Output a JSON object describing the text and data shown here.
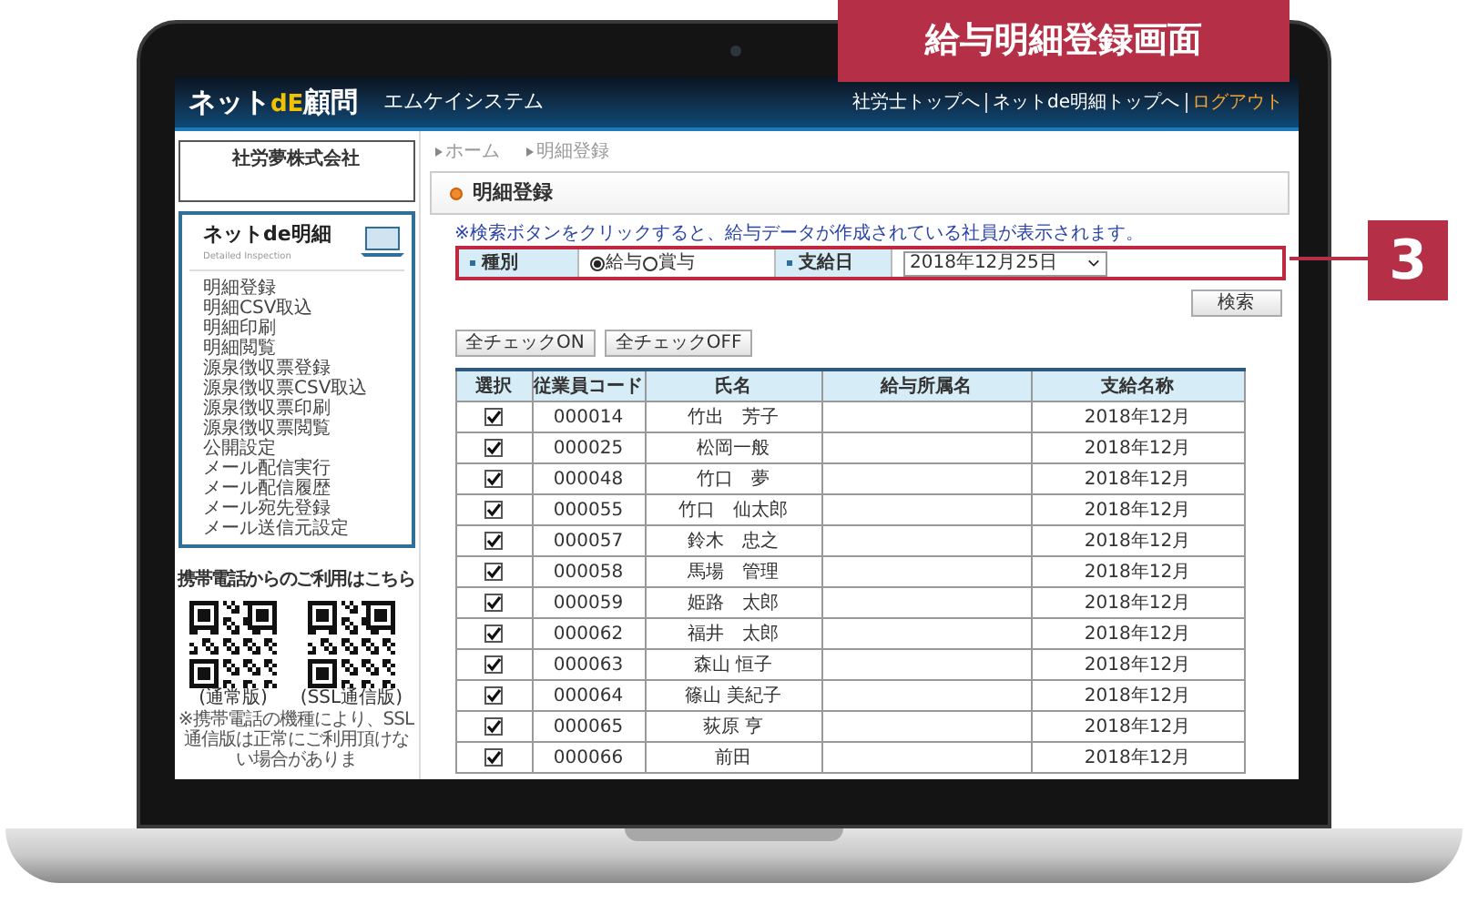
{
  "banner": {
    "title": "給与明細登録画面"
  },
  "callout": {
    "label": "3"
  },
  "header": {
    "logo": {
      "prefix": "ネット",
      "middle": "dE",
      "suffix": "顧問"
    },
    "company": "エムケイシステム",
    "links": [
      {
        "label": "社労士トップへ",
        "kind": "nav"
      },
      {
        "label": "ネットde明細トップへ",
        "kind": "nav"
      },
      {
        "label": "ログアウト",
        "kind": "logout"
      }
    ]
  },
  "sidebar": {
    "company": "社労夢株式会社",
    "menu": {
      "title": "ネットde明細",
      "subtitle": "Detailed Inspection",
      "items": [
        "明細登録",
        "明細CSV取込",
        "明細印刷",
        "明細閲覧",
        "源泉徴収票登録",
        "源泉徴収票CSV取込",
        "源泉徴収票印刷",
        "源泉徴収票閲覧",
        "公開設定",
        "メール配信実行",
        "メール配信履歴",
        "メール宛先登録",
        "メール送信元設定"
      ]
    },
    "mobile": {
      "heading": "携帯電話からのご利用はこちら",
      "qr_labels": [
        "(通常版)",
        "(SSL通信版)"
      ],
      "note": "※携帯電話の機種により、SSL通信版は正常にご利用頂けない場合がありま"
    }
  },
  "main": {
    "breadcrumb": [
      "ホーム",
      "明細登録"
    ],
    "page_title": "明細登録",
    "notice": "※検索ボタンをクリックすると、給与データが作成されている社員が表示されます。",
    "form": {
      "type_label": "種別",
      "options": [
        {
          "label": "給与",
          "selected": true
        },
        {
          "label": "賞与",
          "selected": false
        }
      ],
      "date_label": "支給日",
      "date_value": "2018年12月25日"
    },
    "search_button": "検索",
    "bulk_buttons": [
      "全チェックON",
      "全チェックOFF"
    ],
    "table": {
      "columns": [
        "選択",
        "従業員コード",
        "氏名",
        "給与所属名",
        "支給名称"
      ],
      "rows": [
        {
          "checked": true,
          "code": "000014",
          "name": "竹出　芳子",
          "period": "2018年12月"
        },
        {
          "checked": true,
          "code": "000025",
          "name": "松岡一般",
          "period": "2018年12月"
        },
        {
          "checked": true,
          "code": "000048",
          "name": "竹口　夢",
          "period": "2018年12月"
        },
        {
          "checked": true,
          "code": "000055",
          "name": "竹口　仙太郎",
          "period": "2018年12月"
        },
        {
          "checked": true,
          "code": "000057",
          "name": "鈴木　忠之",
          "period": "2018年12月"
        },
        {
          "checked": true,
          "code": "000058",
          "name": "馬場　管理",
          "period": "2018年12月"
        },
        {
          "checked": true,
          "code": "000059",
          "name": "姫路　太郎",
          "period": "2018年12月"
        },
        {
          "checked": true,
          "code": "000062",
          "name": "福井　太郎",
          "period": "2018年12月"
        },
        {
          "checked": true,
          "code": "000063",
          "name": "森山 恒子",
          "period": "2018年12月"
        },
        {
          "checked": true,
          "code": "000064",
          "name": "篠山 美紀子",
          "period": "2018年12月"
        },
        {
          "checked": true,
          "code": "000065",
          "name": "荻原 亨",
          "period": "2018年12月"
        },
        {
          "checked": true,
          "code": "000066",
          "name": "前田",
          "period": "2018年12月"
        }
      ]
    }
  }
}
